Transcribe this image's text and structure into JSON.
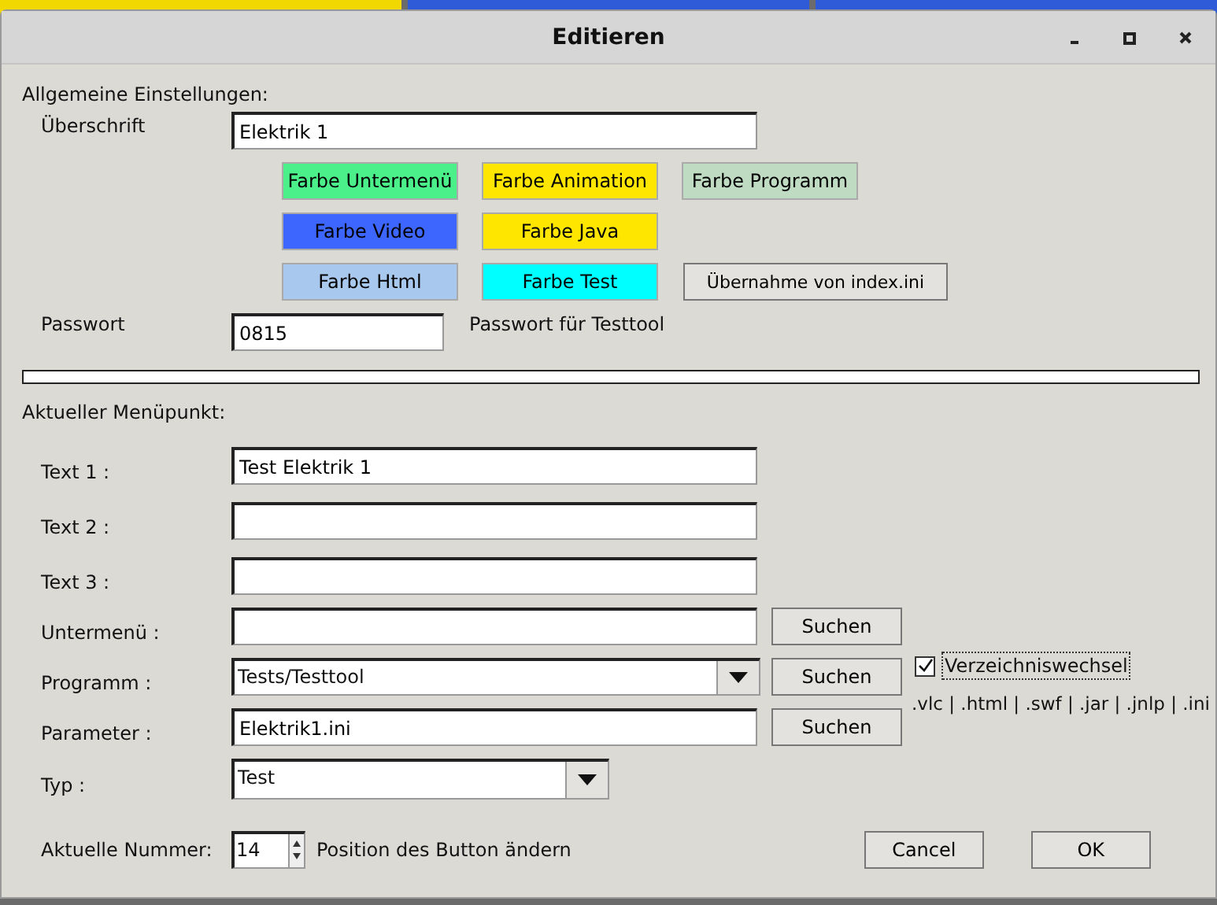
{
  "window": {
    "title": "Editieren"
  },
  "general": {
    "heading": "Allgemeine Einstellungen:",
    "title_label": "Überschrift",
    "title_value": "Elektrik 1",
    "color_buttons": [
      [
        {
          "label": "Farbe Untermenü",
          "color": "#4cf08a"
        },
        {
          "label": "Farbe Animation",
          "color": "#ffe600"
        },
        {
          "label": "Farbe Programm",
          "color": "#bfdcc3"
        }
      ],
      [
        {
          "label": "Farbe Video",
          "color": "#3d66ff"
        },
        {
          "label": "Farbe Java",
          "color": "#ffe600"
        }
      ],
      [
        {
          "label": "Farbe Html",
          "color": "#a8c8ee"
        },
        {
          "label": "Farbe Test",
          "color": "#00ffff"
        }
      ]
    ],
    "import_button": "Übernahme von index.ini",
    "password_label": "Passwort",
    "password_value": "0815",
    "password_hint": "Passwort für Testtool"
  },
  "current": {
    "heading": "Aktueller Menüpunkt:",
    "rows": [
      {
        "kind": "text",
        "label": "Text 1 :",
        "value": "Test Elektrik 1"
      },
      {
        "kind": "text",
        "label": "Text 2 :",
        "value": ""
      },
      {
        "kind": "text",
        "label": "Text 3 :",
        "value": ""
      },
      {
        "kind": "search",
        "label": "Untermenü :",
        "value": "",
        "button": "Suchen"
      },
      {
        "kind": "combo-search",
        "label": "Programm :",
        "value": "Tests/Testtool",
        "button": "Suchen"
      },
      {
        "kind": "search",
        "label": "Parameter :",
        "value": "Elektrik1.ini",
        "button": "Suchen"
      },
      {
        "kind": "combo",
        "label": "Typ :",
        "value": "Test"
      }
    ],
    "dir_change": {
      "label": "Verzeichniswechsel",
      "checked": true
    },
    "extensions": ".vlc | .html | .swf | .jar | .jnlp | .ini"
  },
  "footer": {
    "number_label": "Aktuelle Nummer:",
    "number_value": "14",
    "position_hint": "Position des Button ändern",
    "buttons": [
      "Cancel",
      "OK"
    ]
  }
}
